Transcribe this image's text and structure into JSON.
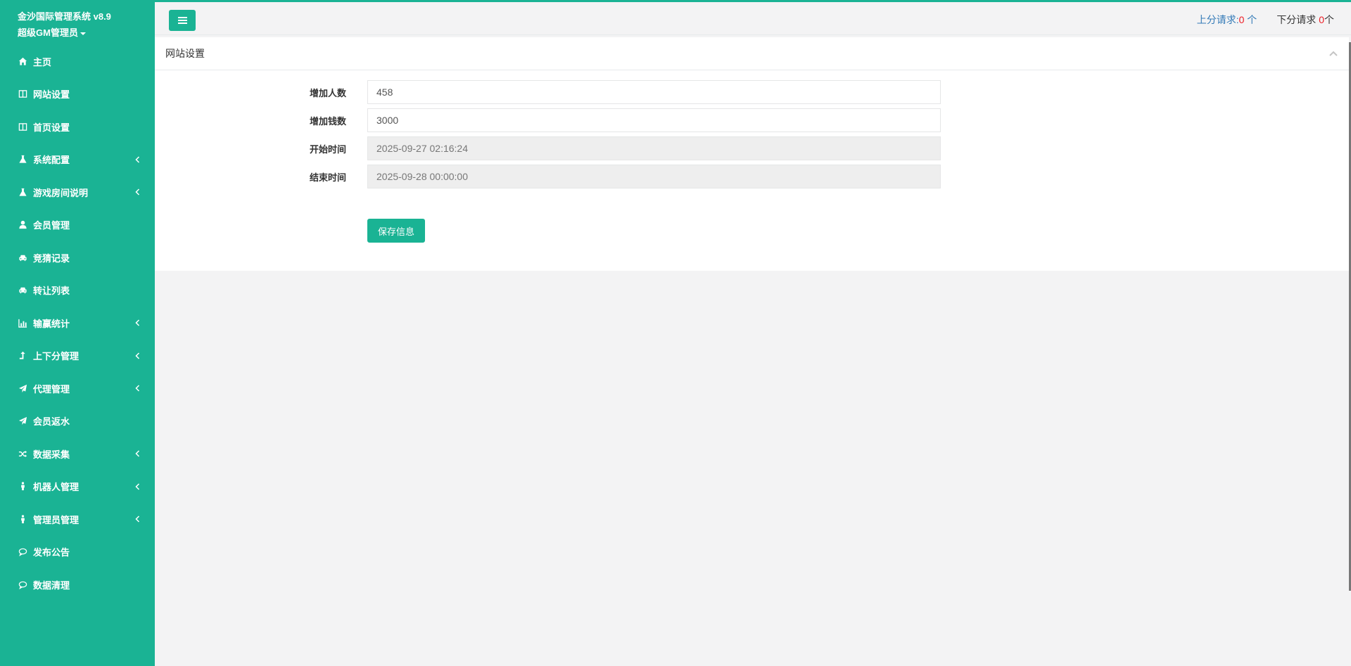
{
  "brand": {
    "title": "金沙国际管理系统 v8.9",
    "user": "超级GM管理员"
  },
  "nav": [
    {
      "label": "主页",
      "icon": "home-icon",
      "has_arrow": false
    },
    {
      "label": "网站设置",
      "icon": "columns-icon",
      "has_arrow": false
    },
    {
      "label": "首页设置",
      "icon": "columns-icon",
      "has_arrow": false
    },
    {
      "label": "系统配置",
      "icon": "flask-icon",
      "has_arrow": true
    },
    {
      "label": "游戏房间说明",
      "icon": "flask-icon",
      "has_arrow": true
    },
    {
      "label": "会员管理",
      "icon": "user-icon",
      "has_arrow": false
    },
    {
      "label": "竞猜记录",
      "icon": "cab-icon",
      "has_arrow": false
    },
    {
      "label": "转让列表",
      "icon": "cab-icon",
      "has_arrow": false
    },
    {
      "label": "输赢统计",
      "icon": "bar-chart-icon",
      "has_arrow": true
    },
    {
      "label": "上下分管理",
      "icon": "level-up-icon",
      "has_arrow": true
    },
    {
      "label": "代理管理",
      "icon": "paper-plane-icon",
      "has_arrow": true
    },
    {
      "label": "会员返水",
      "icon": "paper-plane-icon",
      "has_arrow": false
    },
    {
      "label": "数据采集",
      "icon": "random-icon",
      "has_arrow": true
    },
    {
      "label": "机器人管理",
      "icon": "male-icon",
      "has_arrow": true
    },
    {
      "label": "管理员管理",
      "icon": "male-icon",
      "has_arrow": true
    },
    {
      "label": "发布公告",
      "icon": "comment-icon",
      "has_arrow": false
    },
    {
      "label": "数据清理",
      "icon": "comment-icon",
      "has_arrow": false
    }
  ],
  "header": {
    "up_label": "上分请求:",
    "up_count": "0",
    "up_unit": " 个",
    "down_label": "下分请求 ",
    "down_count": "0",
    "down_unit": "个"
  },
  "panel": {
    "title": "网站设置",
    "fields": [
      {
        "label": "增加人数",
        "value": "458",
        "readonly": false
      },
      {
        "label": "增加钱数",
        "value": "3000",
        "readonly": false
      },
      {
        "label": "开始时间",
        "value": "2025-09-27 02:16:24",
        "readonly": true
      },
      {
        "label": "结束时间",
        "value": "2025-09-28 00:00:00",
        "readonly": true
      }
    ],
    "save_label": "保存信息"
  },
  "colors": {
    "accent": "#1ab394",
    "link": "#337ab7",
    "alert": "#ed1c24"
  }
}
